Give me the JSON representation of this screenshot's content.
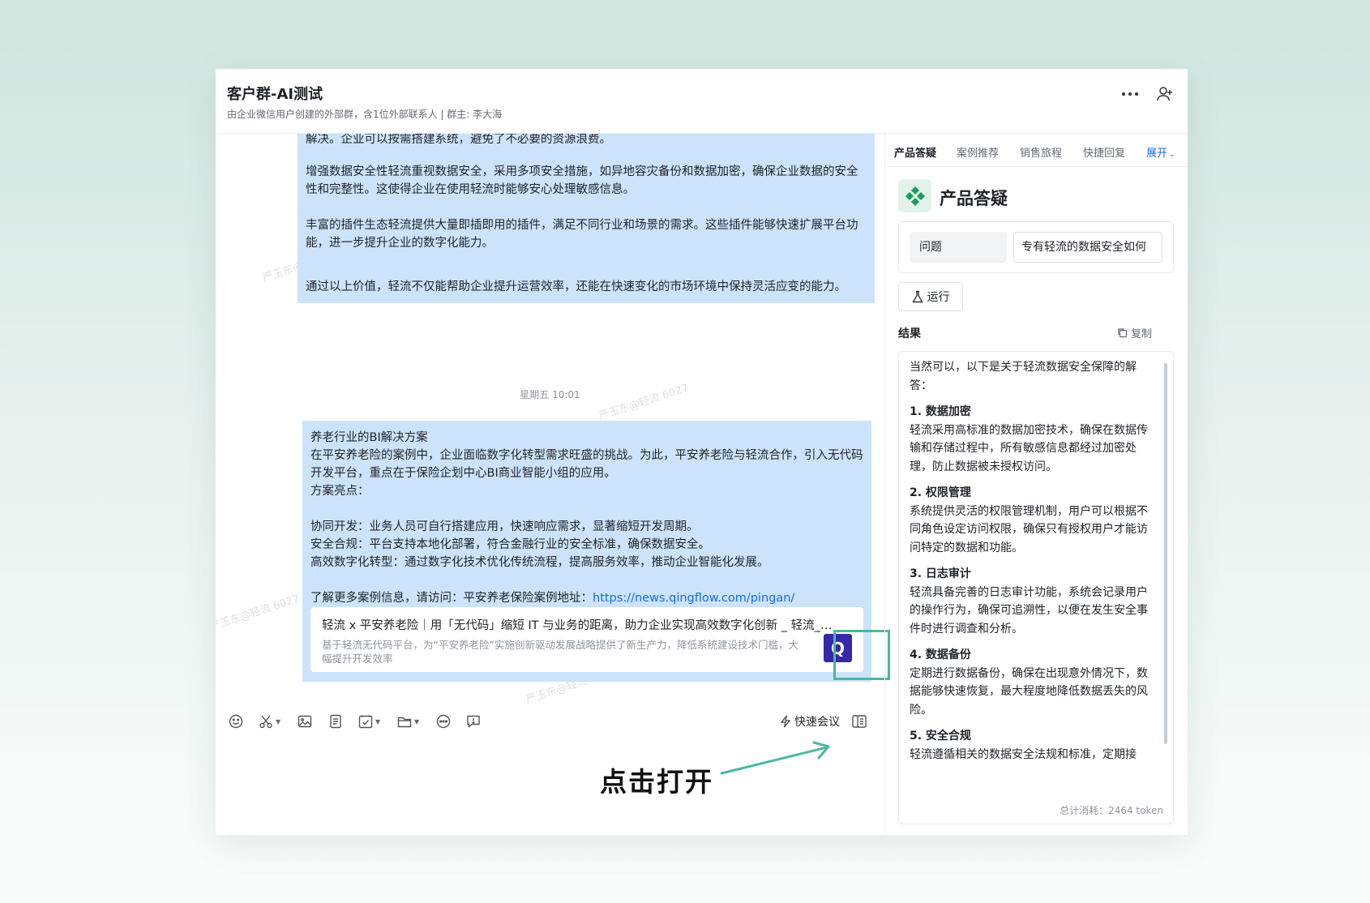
{
  "chat": {
    "title": "客户群-AI测试",
    "subtitle": "由企业微信用户创建的外部群，含1位外部联系人 | 群主: 李大海"
  },
  "watermark": "严玉东@轻流 6027",
  "messages": {
    "first": [
      "解决。企业可以按需搭建系统，避免了不必要的资源浪费。",
      "增强数据安全性轻流重视数据安全，采用多项安全措施，如异地容灾备份和数据加密，确保企业数据的安全性和完整性。这使得企业在使用轻流时能够安心处理敏感信息。",
      "丰富的插件生态轻流提供大量即插即用的插件，满足不同行业和场景的需求。这些插件能够快速扩展平台功能，进一步提升企业的数字化能力。",
      "通过以上价值，轻流不仅能帮助企业提升运营效率，还能在快速变化的市场环境中保持灵活应变的能力。"
    ],
    "timestamp": "星期五 10:01",
    "second": {
      "heading": "养老行业的BI解决方案",
      "intro": "在平安养老险的案例中，企业面临数字化转型需求旺盛的挑战。为此，平安养老险与轻流合作，引入无代码开发平台，重点在于保险企划中心BI商业智能小组的应用。",
      "highlights_label": "方案亮点：",
      "points": [
        "协同开发：业务人员可自行搭建应用，快速响应需求，显著缩短开发周期。",
        "安全合规：平台支持本地化部署，符合金融行业的安全标准，确保数据安全。",
        "高效数字化转型：通过数字化技术优化传统流程，提高服务效率，推动企业智能化发展。"
      ],
      "more_text": "了解更多案例信息，请访问：平安养老保险案例地址：",
      "url": "https://news.qingflow.com/pingan/",
      "card_title": "轻流 x 平安养老险｜用「无代码」缩短 IT 与业务的距离，助力企业实现高效数字化创新 _ 轻流_数字化管理平台",
      "card_desc": "基于轻流无代码平台，为“平安养老险”实施创新驱动发展战略提供了新生产力，降低系统建设技术门槛，大幅提升开发效率",
      "card_logo": "Q"
    }
  },
  "toolbar": {
    "quick_meeting": "快速会议",
    "icons": [
      "emoji-icon",
      "scissors-icon",
      "image-icon",
      "doc-icon",
      "task-icon",
      "folder-icon",
      "more-circle-icon",
      "feedback-icon"
    ]
  },
  "hint": "点击打开",
  "sidebar": {
    "tabs": [
      "产品答疑",
      "案例推荐",
      "销售旅程",
      "快捷回复"
    ],
    "expand": "展开",
    "app_title": "产品答疑",
    "question_label": "问题",
    "question_value": "专有轻流的数据安全如何",
    "run": "运行",
    "result_label": "结果",
    "copy": "复制",
    "result": {
      "intro": "当然可以，以下是关于轻流数据安全保障的解答：",
      "sections": [
        {
          "title": "1. 数据加密",
          "body": "轻流采用高标准的数据加密技术，确保在数据传输和存储过程中，所有敏感信息都经过加密处理，防止数据被未授权访问。"
        },
        {
          "title": "2. 权限管理",
          "body": "系统提供灵活的权限管理机制，用户可以根据不同角色设定访问权限，确保只有授权用户才能访问特定的数据和功能。"
        },
        {
          "title": "3. 日志审计",
          "body": "轻流具备完善的日志审计功能，系统会记录用户的操作行为，确保可追溯性，以便在发生安全事件时进行调查和分析。"
        },
        {
          "title": "4. 数据备份",
          "body": "定期进行数据备份，确保在出现意外情况下，数据能够快速恢复，最大程度地降低数据丢失的风险。"
        },
        {
          "title": "5. 安全合规",
          "body": "轻流遵循相关的数据安全法规和标准，定期接"
        }
      ],
      "token": "总计消耗：2464 token"
    }
  },
  "colors": {
    "bubble": "#cce3fb",
    "accent": "#1a6be6",
    "highlight": "#4bb7a3"
  }
}
